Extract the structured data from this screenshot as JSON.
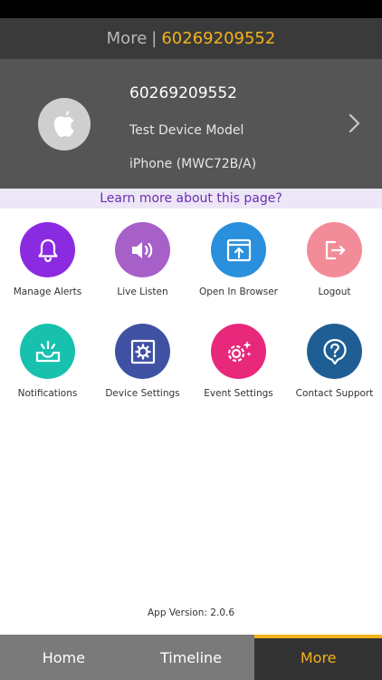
{
  "nav": {
    "prefix": "More",
    "separator": "|",
    "device_id": "60269209552"
  },
  "device": {
    "id": "60269209552",
    "model": "Test Device Model",
    "phone": "iPhone (MWC72B/A)",
    "avatar_icon": "apple-logo-icon"
  },
  "learn_more": "Learn more about this page?",
  "actions": [
    {
      "label": "Manage Alerts",
      "icon": "bell-icon",
      "color": "#8a2be2"
    },
    {
      "label": "Live Listen",
      "icon": "speaker-icon",
      "color": "#a660c8"
    },
    {
      "label": "Open In Browser",
      "icon": "browser-icon",
      "color": "#2a8fdc"
    },
    {
      "label": "Logout",
      "icon": "logout-icon",
      "color": "#f28c98"
    },
    {
      "label": "Notifications",
      "icon": "inbox-icon",
      "color": "#17c1ae"
    },
    {
      "label": "Device Settings",
      "icon": "settings-box-icon",
      "color": "#3f51a3"
    },
    {
      "label": "Event Settings",
      "icon": "gear-sparkle-icon",
      "color": "#e8287a"
    },
    {
      "label": "Contact Support",
      "icon": "help-icon",
      "color": "#1f5e94"
    }
  ],
  "app_version": "App Version: 2.0.6",
  "tabs": [
    {
      "label": "Home",
      "active": false
    },
    {
      "label": "Timeline",
      "active": false
    },
    {
      "label": "More",
      "active": true
    }
  ],
  "colors": {
    "accent": "#f5b21b",
    "link": "#6a2fb3"
  }
}
